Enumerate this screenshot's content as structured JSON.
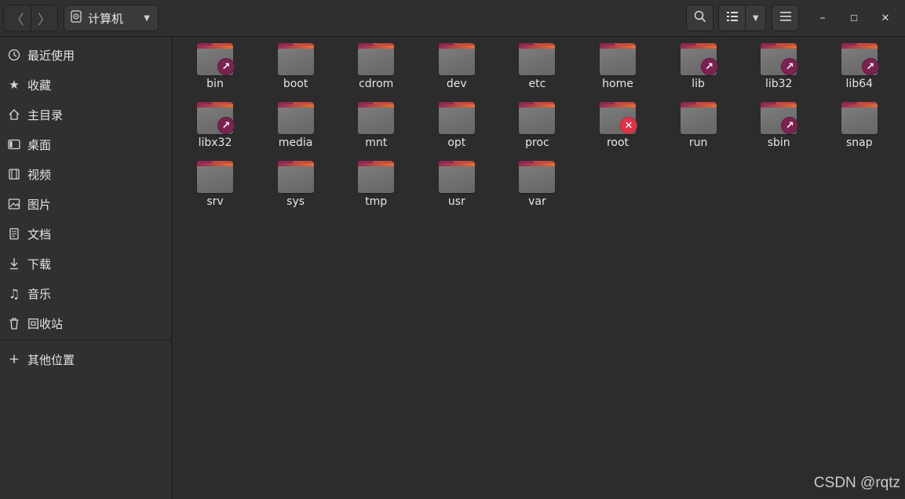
{
  "header": {
    "back_glyph": "〈",
    "forward_glyph": "〉",
    "location_label": "计算机",
    "location_icon": "drive-icon",
    "search_icon": "search-icon",
    "view_icon": "list-view-icon",
    "menu_icon": "hamburger-icon"
  },
  "window_controls": {
    "minimize": "–",
    "maximize": "☐",
    "close": "✕"
  },
  "sidebar": {
    "items": [
      {
        "label": "最近使用",
        "icon": "clock-icon"
      },
      {
        "label": "收藏",
        "icon": "star-icon"
      },
      {
        "label": "主目录",
        "icon": "home-icon"
      },
      {
        "label": "桌面",
        "icon": "desktop-icon"
      },
      {
        "label": "视频",
        "icon": "video-icon"
      },
      {
        "label": "图片",
        "icon": "picture-icon"
      },
      {
        "label": "文档",
        "icon": "document-icon"
      },
      {
        "label": "下载",
        "icon": "download-icon"
      },
      {
        "label": "音乐",
        "icon": "music-icon"
      },
      {
        "label": "回收站",
        "icon": "trash-icon"
      }
    ],
    "other_locations": {
      "label": "其他位置",
      "icon": "plus-icon"
    }
  },
  "files": [
    {
      "name": "bin",
      "emblem": "link"
    },
    {
      "name": "boot",
      "emblem": ""
    },
    {
      "name": "cdrom",
      "emblem": ""
    },
    {
      "name": "dev",
      "emblem": ""
    },
    {
      "name": "etc",
      "emblem": ""
    },
    {
      "name": "home",
      "emblem": ""
    },
    {
      "name": "lib",
      "emblem": "link"
    },
    {
      "name": "lib32",
      "emblem": "link"
    },
    {
      "name": "lib64",
      "emblem": "link"
    },
    {
      "name": "libx32",
      "emblem": "link"
    },
    {
      "name": "media",
      "emblem": ""
    },
    {
      "name": "mnt",
      "emblem": ""
    },
    {
      "name": "opt",
      "emblem": ""
    },
    {
      "name": "proc",
      "emblem": ""
    },
    {
      "name": "root",
      "emblem": "locked"
    },
    {
      "name": "run",
      "emblem": ""
    },
    {
      "name": "sbin",
      "emblem": "link"
    },
    {
      "name": "snap",
      "emblem": ""
    },
    {
      "name": "srv",
      "emblem": ""
    },
    {
      "name": "sys",
      "emblem": ""
    },
    {
      "name": "tmp",
      "emblem": ""
    },
    {
      "name": "usr",
      "emblem": ""
    },
    {
      "name": "var",
      "emblem": ""
    }
  ],
  "watermark": "CSDN @rqtz",
  "colors": {
    "background": "#2c2c2c",
    "sidebar": "#303030",
    "folder_accent": "#e86f2f",
    "folder_tab": "#8a2a55",
    "link_emblem": "#7a2350",
    "locked_emblem": "#e0334a"
  }
}
